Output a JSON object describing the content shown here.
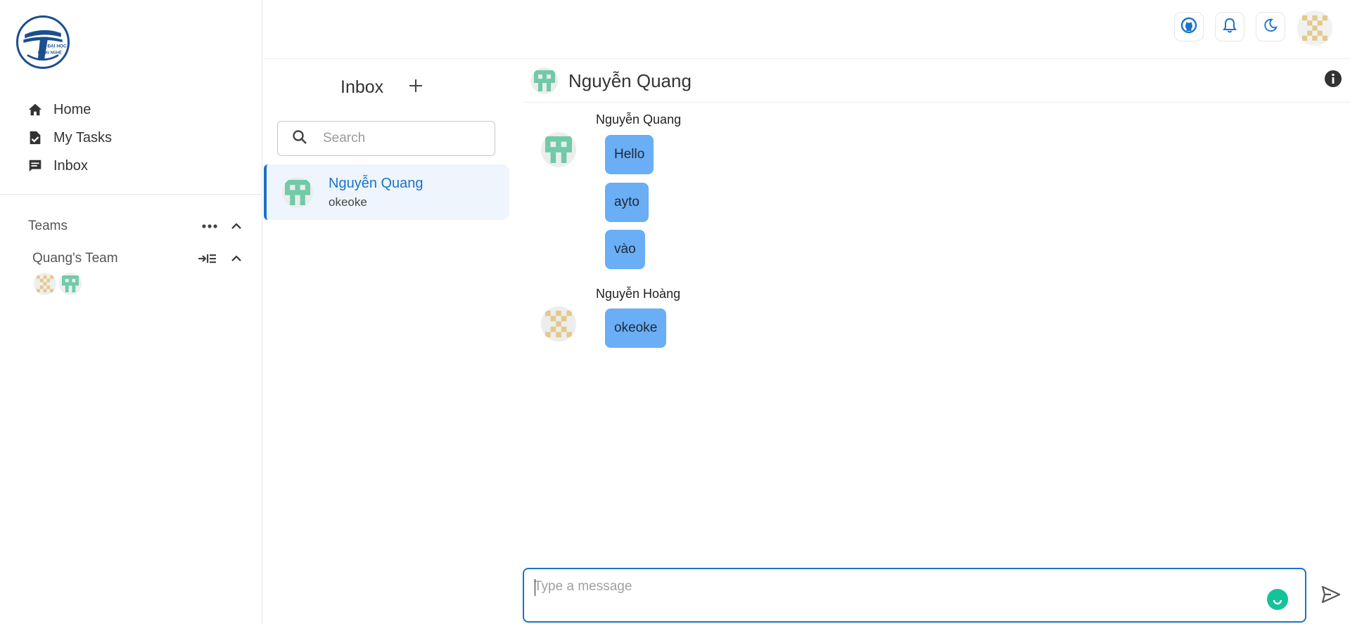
{
  "app": {
    "logo_text_top": "ĐẠI HỌC",
    "logo_text_bottom": "CÔNG NGHỆ",
    "accent_color": "#1a73c8",
    "bubble_color": "#6aaef5"
  },
  "sidebar": {
    "nav": [
      {
        "label": "Home",
        "icon": "home-icon"
      },
      {
        "label": "My Tasks",
        "icon": "task-check-icon"
      },
      {
        "label": "Inbox",
        "icon": "chat-icon"
      }
    ],
    "teams_label": "Teams",
    "team": {
      "name": "Quang's Team"
    }
  },
  "topbar": {
    "icons": [
      "github-icon",
      "bell-icon",
      "moon-icon"
    ]
  },
  "inbox": {
    "title": "Inbox",
    "search_placeholder": "Search",
    "conversations": [
      {
        "name": "Nguyễn Quang",
        "preview": "okeoke"
      }
    ]
  },
  "chat": {
    "header_name": "Nguyễn Quang",
    "groups": [
      {
        "sender": "Nguyễn Quang",
        "messages": [
          "Hello",
          "ayto",
          "vào"
        ]
      },
      {
        "sender": "Nguyễn Hoàng",
        "messages": [
          "okeoke"
        ]
      }
    ],
    "composer_placeholder": "Type a message"
  }
}
